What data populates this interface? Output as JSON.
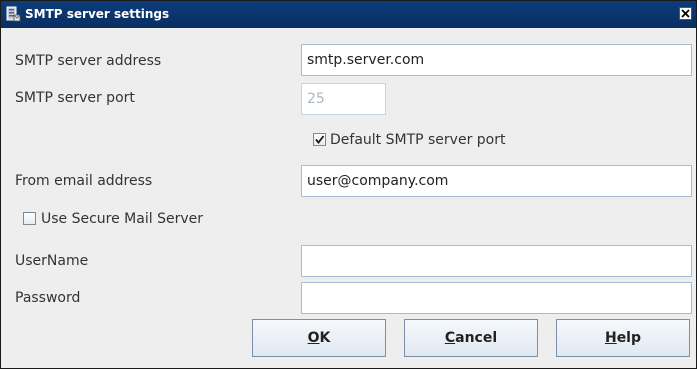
{
  "window": {
    "title": "SMTP server settings"
  },
  "form": {
    "server_address": {
      "label": "SMTP server address",
      "value": "smtp.server.com"
    },
    "server_port": {
      "label": "SMTP server port",
      "value": "25",
      "enabled": false
    },
    "default_port": {
      "label": "Default SMTP server port",
      "checked": true
    },
    "from_email": {
      "label": "From email address",
      "value": "user@company.com"
    },
    "secure_server": {
      "label": "Use Secure Mail Server",
      "checked": false
    },
    "username": {
      "label": "UserName",
      "value": ""
    },
    "password": {
      "label": "Password",
      "value": ""
    }
  },
  "buttons": {
    "ok": {
      "mnemonic": "O",
      "rest": "K"
    },
    "cancel": {
      "mnemonic": "C",
      "rest": "ancel"
    },
    "help": {
      "mnemonic": "H",
      "rest": "elp"
    }
  },
  "icons": {
    "title": "server-settings-icon",
    "close": "close-icon",
    "check": "checkmark-icon"
  }
}
